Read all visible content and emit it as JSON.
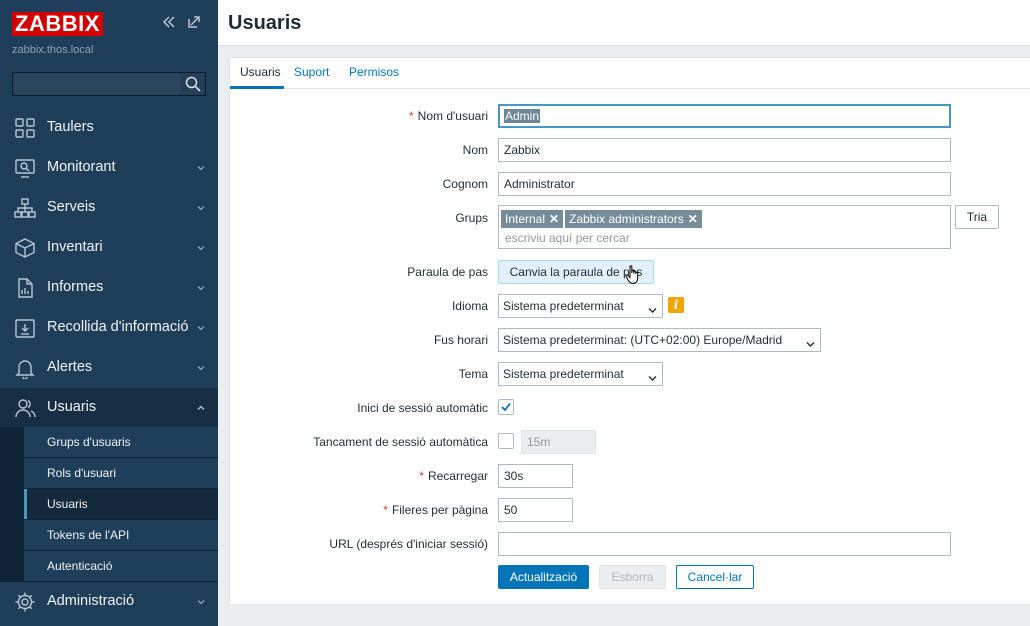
{
  "sidebar": {
    "logo": "ZABBIX",
    "hostname": "zabbix.thos.local",
    "search_placeholder": "",
    "menu": [
      {
        "label": "Taulers",
        "icon": "dashboard-icon"
      },
      {
        "label": "Monitorant",
        "icon": "monitoring-icon"
      },
      {
        "label": "Serveis",
        "icon": "services-icon"
      },
      {
        "label": "Inventari",
        "icon": "inventory-icon"
      },
      {
        "label": "Informes",
        "icon": "reports-icon"
      },
      {
        "label": "Recollida d'informació",
        "icon": "data-collection-icon"
      },
      {
        "label": "Alertes",
        "icon": "bell-icon"
      },
      {
        "label": "Usuaris",
        "icon": "users-icon"
      },
      {
        "label": "Administració",
        "icon": "gear-icon"
      }
    ],
    "submenu": [
      {
        "label": "Grups d'usuaris"
      },
      {
        "label": "Rols d'usuari"
      },
      {
        "label": "Usuaris"
      },
      {
        "label": "Tokens de l'API"
      },
      {
        "label": "Autenticació"
      }
    ]
  },
  "header": {
    "title": "Usuaris"
  },
  "tabs": [
    {
      "label": "Usuaris"
    },
    {
      "label": "Suport"
    },
    {
      "label": "Permisos"
    }
  ],
  "form": {
    "username": {
      "label": "Nom d'usuari",
      "value": "Admin"
    },
    "name": {
      "label": "Nom",
      "value": "Zabbix"
    },
    "surname": {
      "label": "Cognom",
      "value": "Administrator"
    },
    "groups": {
      "label": "Grups",
      "chips": [
        "Internal",
        "Zabbix administrators"
      ],
      "placeholder": "escriviu aquí per cercar",
      "select_button": "Tria"
    },
    "password": {
      "label": "Paraula de pas",
      "button": "Canvia la paraula de pas"
    },
    "language": {
      "label": "Idioma",
      "value": "Sistema predeterminat"
    },
    "timezone": {
      "label": "Fus horari",
      "value": "Sistema predeterminat: (UTC+02:00) Europe/Madrid"
    },
    "theme": {
      "label": "Tema",
      "value": "Sistema predeterminat"
    },
    "autologin": {
      "label": "Inici de sessió automàtic",
      "checked": true
    },
    "autologout": {
      "label": "Tancament de sessió automàtica",
      "checked": false,
      "value": "15m"
    },
    "refresh": {
      "label": "Recarregar",
      "value": "30s"
    },
    "rows_per_page": {
      "label": "Fileres per pàgina",
      "value": "50"
    },
    "url": {
      "label": "URL (després d'iniciar sessió)",
      "value": ""
    }
  },
  "buttons": {
    "update": "Actualització",
    "delete": "Esborra",
    "cancel": "Cancel·lar"
  },
  "colors": {
    "sidebar_bg": "#1f3e5a",
    "brand_red": "#d40000",
    "accent_blue": "#0275b8",
    "required": "#e33734",
    "warning": "#f0a500"
  }
}
